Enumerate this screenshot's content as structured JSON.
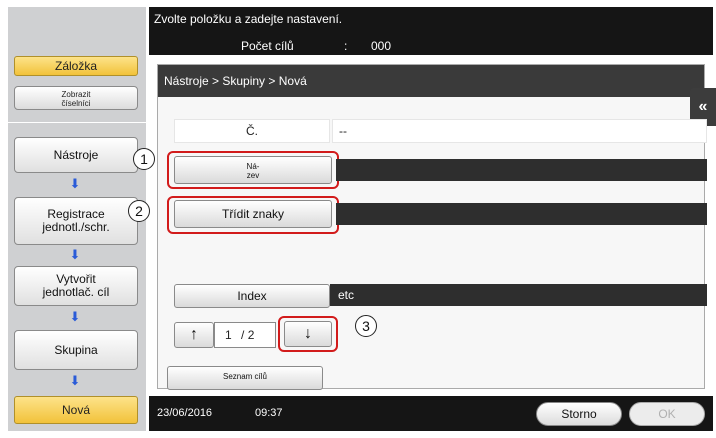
{
  "header": {
    "instruction": "Zvolte položku a zadejte nastavení.",
    "target_count_label": "Počet cílů",
    "target_count_separator": ":",
    "target_count_value": "000"
  },
  "sidebar": {
    "bookmark_label": "Záložka",
    "show_keypad_label": "Zobrazit\nčíselníci",
    "steps": [
      {
        "label": "Nástroje"
      },
      {
        "label": "Registrace\njednotl./schr."
      },
      {
        "label": "Vytvořit\njednotlač. cíl"
      },
      {
        "label": "Skupina"
      },
      {
        "label": "Nová"
      }
    ]
  },
  "main": {
    "breadcrumb": "Nástroje > Skupiny > Nová",
    "number_label": "Č.",
    "number_value": "--",
    "name_label": "Ná-\nzev",
    "name_value": "",
    "sort_chars_label": "Třídit znaky",
    "sort_chars_value": "",
    "index_label": "Index",
    "index_value": "etc",
    "page_current": "1",
    "page_total": "/ 2",
    "target_list_label": "Seznam cílů",
    "collapse_icon": "double-chevron-left-icon"
  },
  "annotations": {
    "callout_1": "1",
    "callout_2": "2",
    "callout_3": "3"
  },
  "footer": {
    "date": "23/06/2016",
    "time": "09:37",
    "cancel_label": "Storno",
    "ok_label": "OK"
  },
  "colors": {
    "highlight_yellow": "#f2c23a",
    "callout_red": "#d21b1b",
    "nav_arrow_blue": "#2a5bd8",
    "header_black": "#151515"
  }
}
